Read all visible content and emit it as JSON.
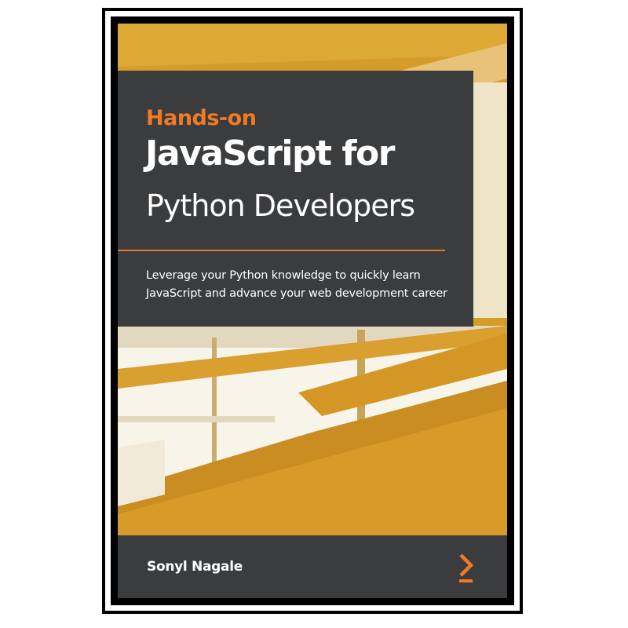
{
  "book": {
    "title_prefix": "Hands-on",
    "title_main": "JavaScript for",
    "title_sub": "Python Developers",
    "tagline_line1": "Leverage your Python knowledge to quickly learn",
    "tagline_line2": "JavaScript and advance your web development career",
    "author": "Sonyl Nagale"
  },
  "colors": {
    "panel": "#3b3c3e",
    "accent": "#f07a25",
    "cover_orange": "#d9a02c",
    "frame": "#000000"
  },
  "icons": {
    "publisher_logo": "chevron-right-icon"
  }
}
